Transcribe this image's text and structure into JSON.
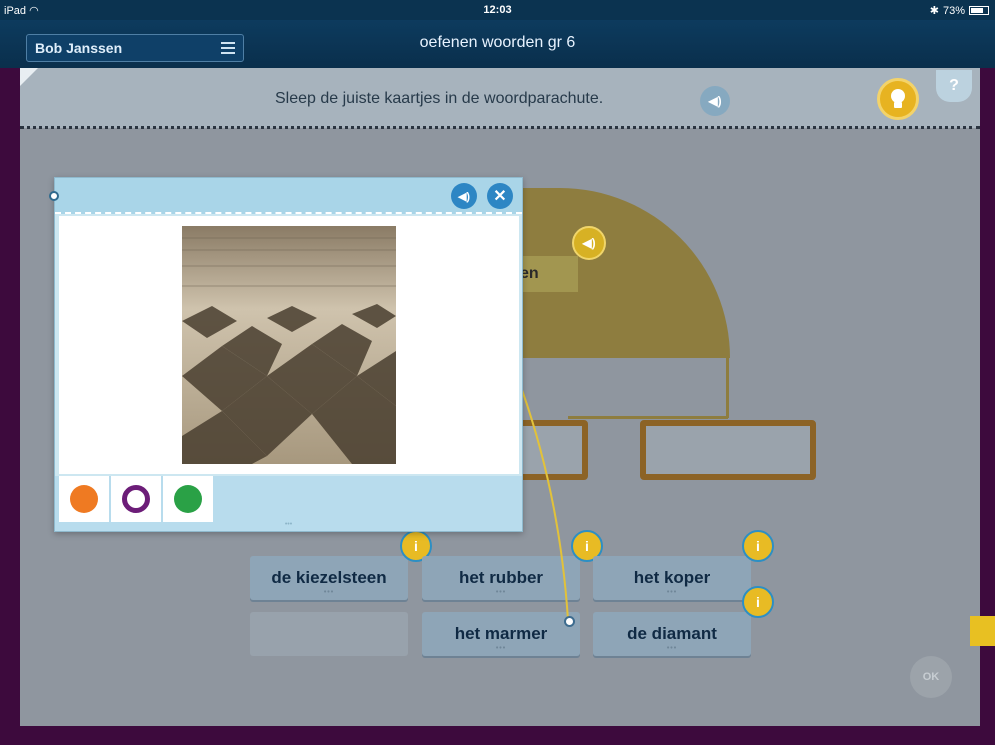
{
  "status": {
    "device": "iPad",
    "wifi": "wifi-icon",
    "time": "12:03",
    "bluetooth": "bluetooth-icon",
    "battery": "73%"
  },
  "appbar": {
    "user_name": "Bob Janssen",
    "menu_icon": "menu-icon",
    "title": "oefenen woorden gr 6"
  },
  "exercise": {
    "instruction": "Sleep de juiste kaartjes in de woordparachute.",
    "instruction_audio_icon": "speaker-icon",
    "hint_icon": "lightbulb-icon",
    "help_label": "?",
    "parachute_label": "en",
    "cards": [
      {
        "label": "de kiezelsteen",
        "info": "i"
      },
      {
        "label": "het rubber",
        "info": "i"
      },
      {
        "label": "het koper",
        "info": "i"
      },
      {
        "label": ""
      },
      {
        "label": "het marmer"
      },
      {
        "label": "de diamant",
        "info": "i"
      }
    ],
    "ok_label": "OK"
  },
  "popup": {
    "audio_icon": "speaker-icon",
    "close_icon": "close-icon",
    "image_subject": "marble checkerboard floor",
    "tools": [
      "list-icon",
      "speech-bubble-icon",
      "screen-icon"
    ],
    "grip": "•••"
  },
  "colors": {
    "appbar": "#0b3350",
    "stage": "#8f969f",
    "accent_yellow": "#e8bb24",
    "popup_blue": "#a9d5e8",
    "card": "#8ea5b7"
  }
}
